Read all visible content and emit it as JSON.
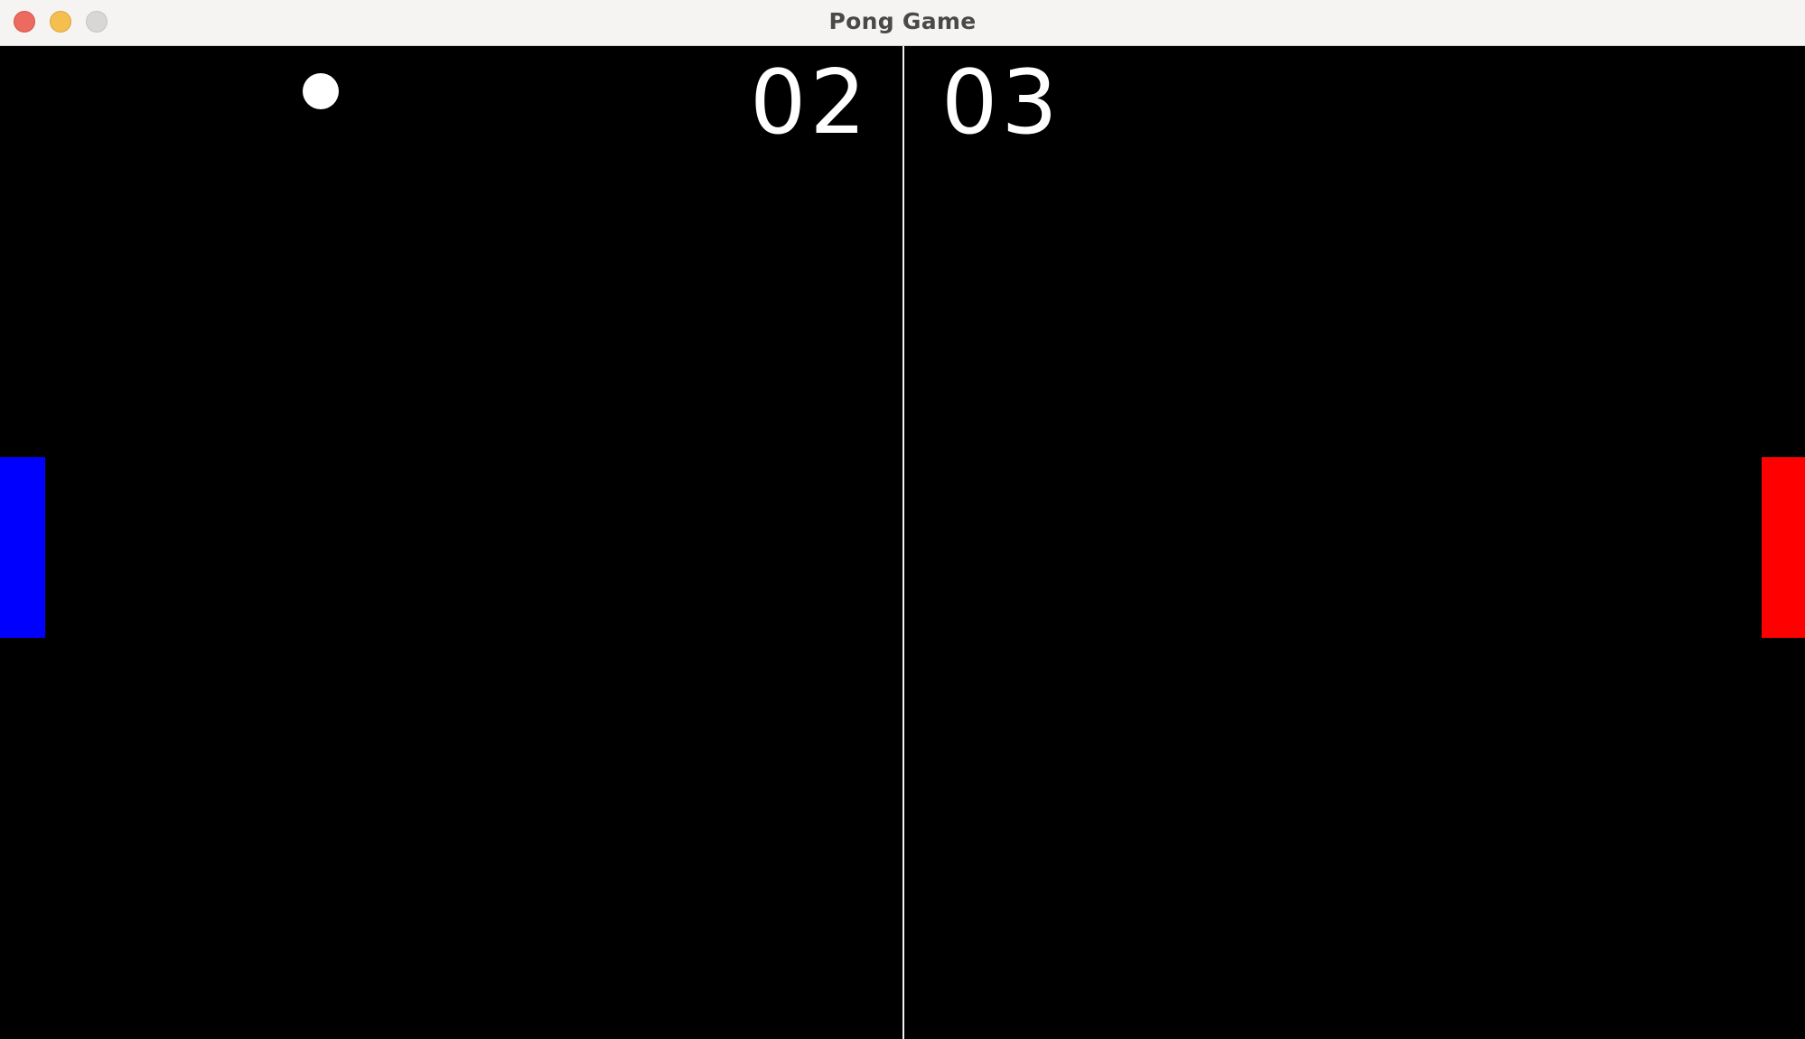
{
  "window": {
    "title": "Pong Game"
  },
  "scoreboard": {
    "left_score": "02",
    "right_score": "03"
  },
  "colors": {
    "background": "#000000",
    "net": "#f2f2f2",
    "ball": "#ffffff",
    "left_paddle": "#0000ff",
    "right_paddle": "#ff0000"
  }
}
